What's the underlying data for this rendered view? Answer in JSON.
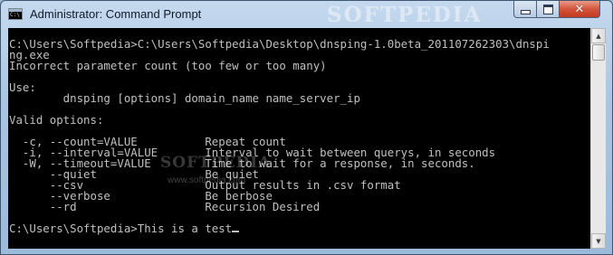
{
  "window": {
    "title": "Administrator: Command Prompt",
    "watermark": "SOFTPEDIA",
    "controls": {
      "minimize": "minimize",
      "maximize": "maximize",
      "close": "✕"
    }
  },
  "console": {
    "lines": [
      "C:\\Users\\Softpedia>C:\\Users\\Softpedia\\Desktop\\dnsping-1.0beta_201107262303\\dnspi",
      "ng.exe",
      "Incorrect parameter count (too few or too many)",
      "",
      "Use:",
      "        dnsping [options] domain_name name_server_ip",
      "",
      "Valid options:",
      "",
      "  -c, --count=VALUE          Repeat count",
      "  -i, --interval=VALUE       Interval to wait between querys, in seconds",
      "  -W, --timeout=VALUE        Time to wait for a response, in seconds.",
      "      --quiet                Be quiet",
      "      --csv                  Output results in .csv format",
      "      --verbose              Be berbose",
      "      --rd                   Recursion Desired",
      "",
      "C:\\Users\\Softpedia>This is a test"
    ],
    "watermark": "SOFTPEDIA",
    "watermark_url": "www.softpedia.com"
  },
  "colors": {
    "console_bg": "#000000",
    "console_fg": "#c0c0c0",
    "close_button": "#c7432a"
  },
  "icons": {
    "app": "cmd-icon",
    "scroll_up": "scroll-up-arrow-icon",
    "scroll_down": "scroll-down-arrow-icon"
  }
}
